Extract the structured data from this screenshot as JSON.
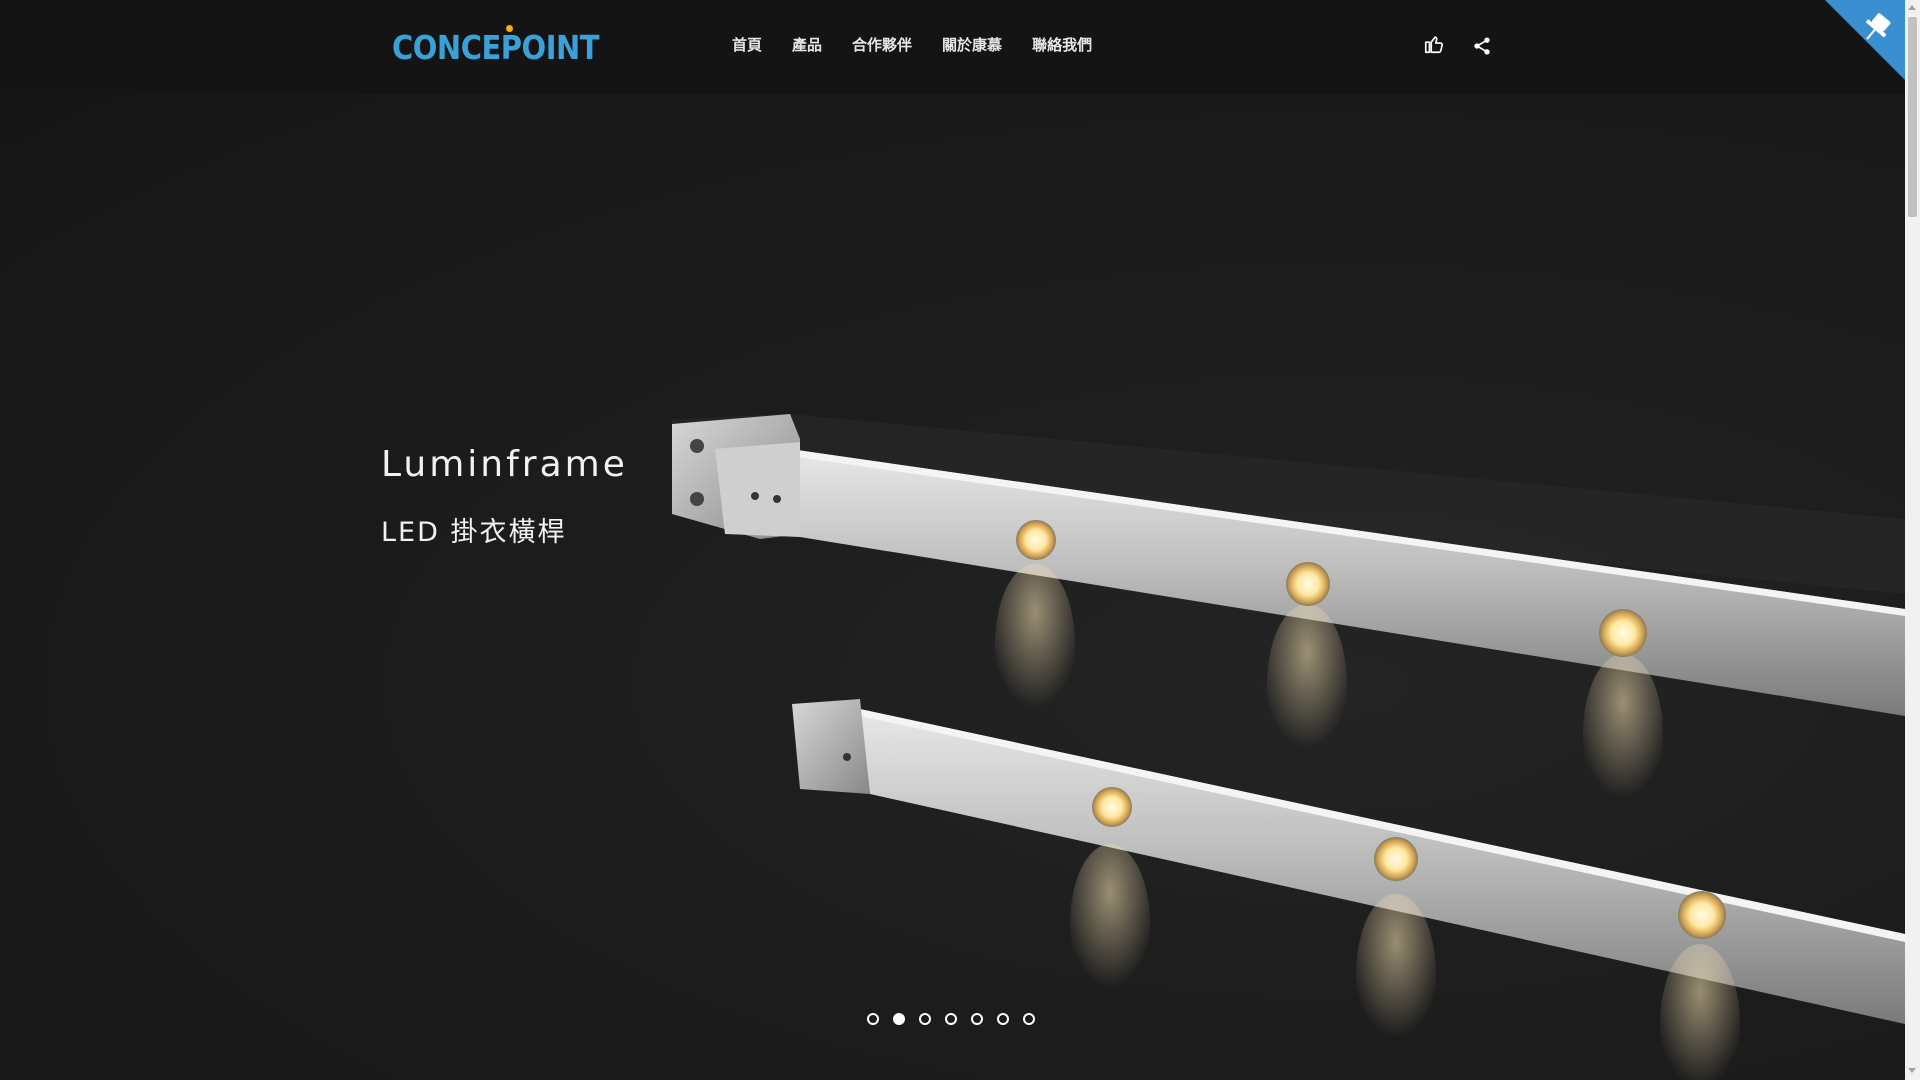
{
  "header": {
    "logo_text": "CONCEPOINT",
    "nav": [
      "首頁",
      "產品",
      "合作夥伴",
      "關於康慕",
      "聯絡我們"
    ],
    "like_icon": "thumbs-up-icon",
    "share_icon": "share-icon"
  },
  "corner_icon": "pushpin-icon",
  "hero": {
    "title": "Luminframe",
    "subtitle": "LED 掛衣橫桿",
    "slide_count": 7,
    "active_slide": 2
  },
  "colors": {
    "header_bg": "#141414",
    "logo": "#3aa0d8",
    "logo_dot": "#f5b100",
    "corner": "#3a8fd0",
    "hero_bg": "#1c1c1c"
  }
}
